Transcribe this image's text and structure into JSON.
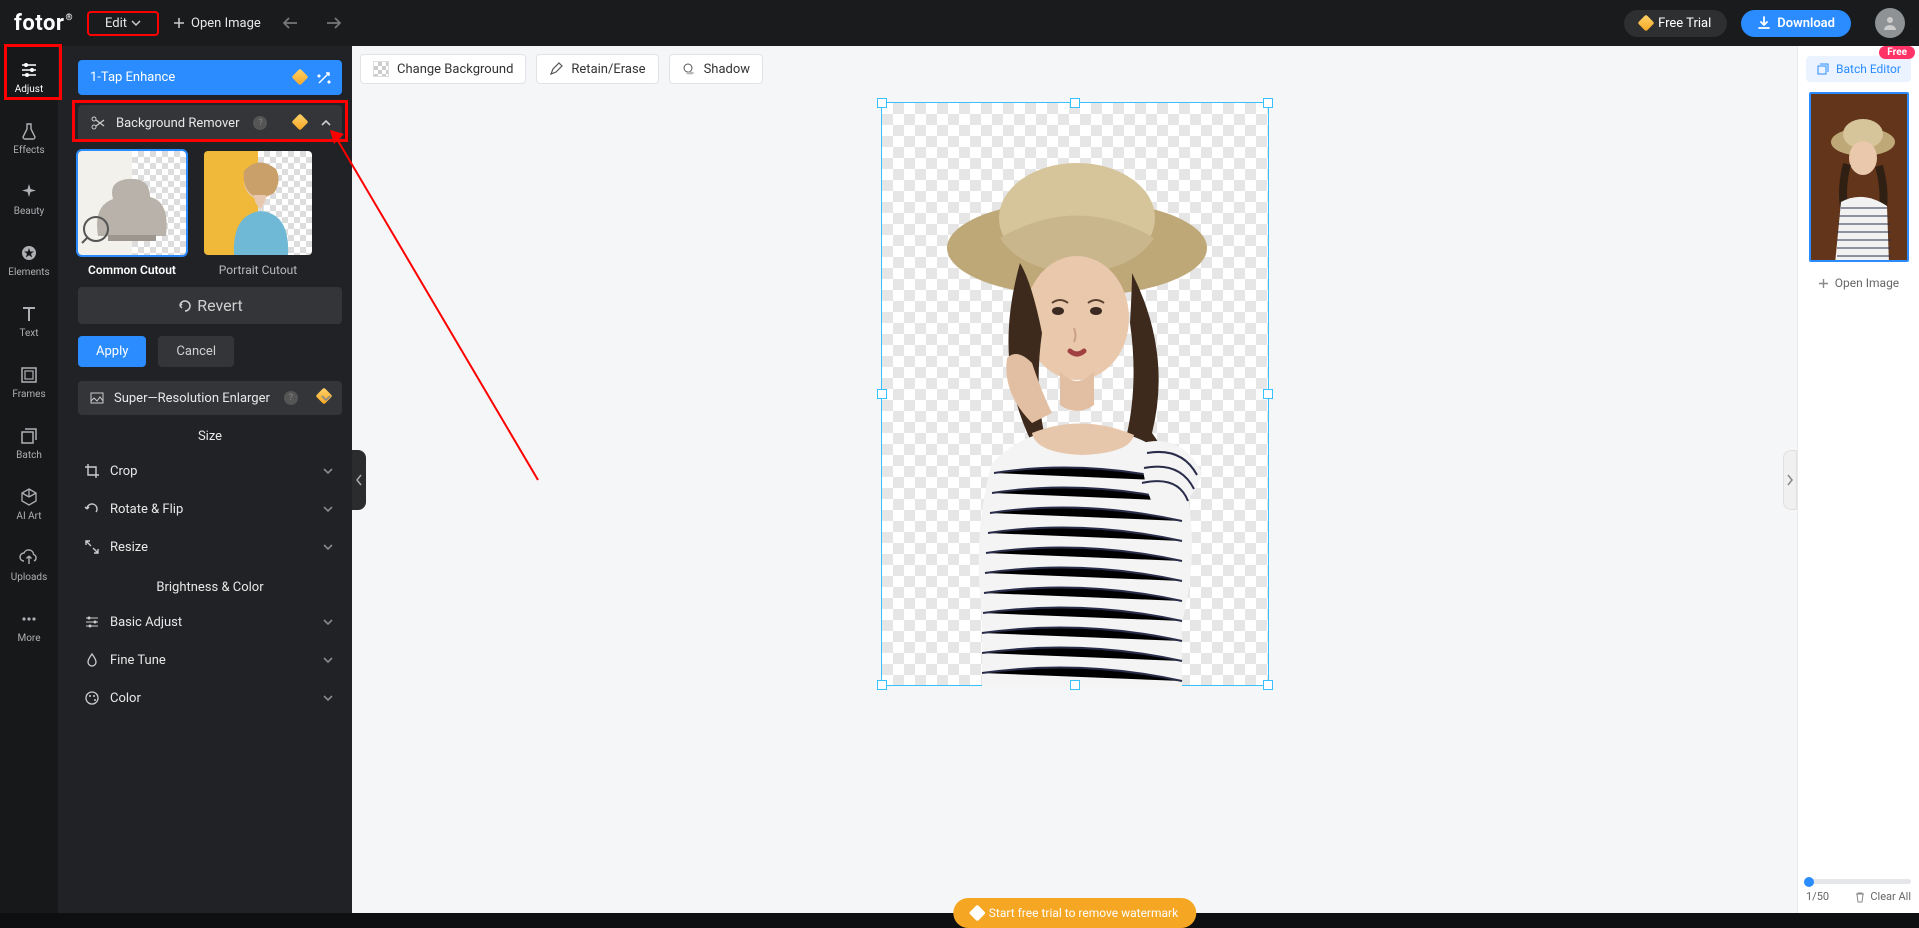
{
  "topbar": {
    "logo": "fotor",
    "edit_label": "Edit",
    "open_image": "Open Image",
    "free_trial": "Free Trial",
    "download": "Download"
  },
  "rail": [
    {
      "id": "adjust",
      "label": "Adjust",
      "active": true
    },
    {
      "id": "effects",
      "label": "Effects"
    },
    {
      "id": "beauty",
      "label": "Beauty"
    },
    {
      "id": "elements",
      "label": "Elements"
    },
    {
      "id": "text",
      "label": "Text"
    },
    {
      "id": "frames",
      "label": "Frames"
    },
    {
      "id": "batch",
      "label": "Batch"
    },
    {
      "id": "aiart",
      "label": "AI Art"
    },
    {
      "id": "uploads",
      "label": "Uploads"
    },
    {
      "id": "more",
      "label": "More"
    }
  ],
  "panel": {
    "one_tap": "1-Tap Enhance",
    "bg_remover": "Background Remover",
    "cutouts": {
      "common": "Common Cutout",
      "portrait": "Portrait Cutout"
    },
    "revert": "Revert",
    "apply": "Apply",
    "cancel": "Cancel",
    "super_res": "Super—Resolution Enlarger",
    "size_title": "Size",
    "crop": "Crop",
    "rotate": "Rotate & Flip",
    "resize": "Resize",
    "bc_title": "Brightness & Color",
    "basic": "Basic Adjust",
    "fine": "Fine Tune",
    "color": "Color"
  },
  "canvas_toolbar": {
    "change_bg": "Change Background",
    "retain": "Retain/Erase",
    "shadow": "Shadow"
  },
  "watermark": "Start free trial to remove watermark",
  "rstrip": {
    "batch": "Batch Editor",
    "free": "Free",
    "open_image": "Open Image",
    "count": "1/50",
    "clear": "Clear All"
  }
}
